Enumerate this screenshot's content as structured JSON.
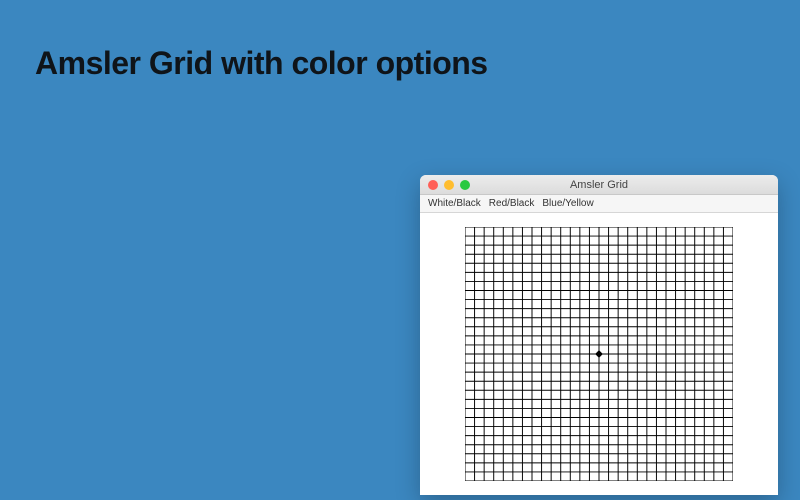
{
  "headline": "Amsler Grid with color options",
  "window": {
    "title": "Amsler Grid",
    "traffic_lights": {
      "close": "#ff5f57",
      "minimize": "#ffbd2e",
      "maximize": "#28c940"
    }
  },
  "menu": {
    "items": [
      "White/Black",
      "Red/Black",
      "Blue/Yellow"
    ]
  },
  "grid": {
    "cols": 28,
    "rows": 28,
    "line_color": "#000000",
    "background": "#ffffff",
    "center_dot": true
  }
}
